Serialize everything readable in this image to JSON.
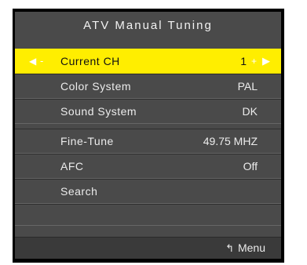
{
  "title": "ATV Manual Tuning",
  "items": [
    {
      "label": "Current CH",
      "value": "1",
      "selected": true
    },
    {
      "label": "Color System",
      "value": "PAL"
    },
    {
      "label": "Sound System",
      "value": "DK"
    },
    {
      "label": "Fine-Tune",
      "value": "49.75 MHZ"
    },
    {
      "label": "AFC",
      "value": "Off"
    },
    {
      "label": "Search",
      "value": ""
    }
  ],
  "selector": {
    "left_arrow_icon": "triangle-left",
    "minus": "-",
    "plus": "+",
    "right_arrow_icon": "triangle-right"
  },
  "footer": {
    "return_icon": "return-arrow-icon",
    "menu_label": "Menu"
  },
  "colors": {
    "highlight": "#ffee00",
    "panel": "#4a4a4a",
    "frame": "#000000"
  }
}
